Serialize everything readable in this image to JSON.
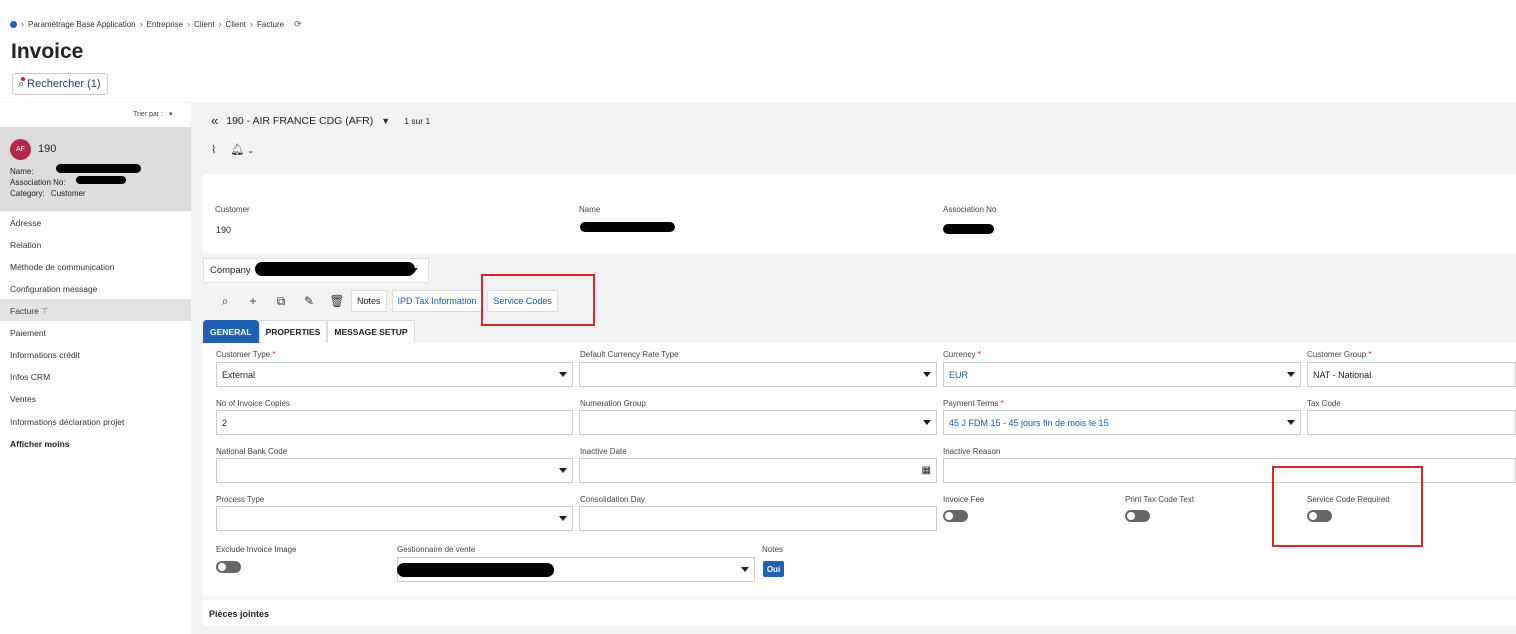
{
  "breadcrumb": [
    "Paramétrage Base Application",
    "Entreprise",
    "Client",
    "Client",
    "Facture"
  ],
  "page_title": "Invoice",
  "search_button": "Rechercher (1)",
  "sidebar": {
    "sort_label": "Trier par :",
    "card": {
      "avatar": "AF",
      "id": "190",
      "name_label": "Name:",
      "association_label": "Association No:",
      "category_label": "Category:",
      "category_value": "Customer"
    },
    "items": [
      "Adresse",
      "Relation",
      "Méthode de communication",
      "Configuration message",
      "Facture",
      "Paiement",
      "Informations crédit",
      "Infos CRM",
      "Ventes",
      "Informations déclaration projet"
    ],
    "show_less": "Afficher moins"
  },
  "record_nav": {
    "record": "190 - AIR FRANCE CDG (AFR)",
    "count": "1 sur 1"
  },
  "header_fields": {
    "customer_label": "Customer",
    "customer_value": "190",
    "name_label": "Name",
    "association_label": "Association No"
  },
  "company_label": "Company",
  "toolbar": {
    "notes": "Notes",
    "ipd": "IPD Tax Information",
    "service_codes": "Service Codes"
  },
  "tabs": [
    "GENERAL",
    "PROPERTIES",
    "MESSAGE SETUP"
  ],
  "form": {
    "customer_type_label": "Customer Type",
    "customer_type_value": "External",
    "default_currency_rate_type_label": "Default Currency Rate Type",
    "currency_label": "Currency",
    "currency_value": "EUR",
    "customer_group_label": "Customer Group",
    "customer_group_value": "NAT - National",
    "invoice_copies_label": "No of Invoice Copies",
    "invoice_copies_value": "2",
    "numeration_group_label": "Numeration Group",
    "payment_terms_label": "Payment Terms",
    "payment_terms_value": "45 J FDM 15 - 45 jours fin de mois le 15",
    "tax_code_label": "Tax Code",
    "national_bank_code_label": "National Bank Code",
    "inactive_date_label": "Inactive Date",
    "inactive_reason_label": "Inactive Reason",
    "process_type_label": "Process Type",
    "consolidation_day_label": "Consolidation Day",
    "invoice_fee_label": "Invoice Fee",
    "print_tax_code_text_label": "Print Tax Code Text",
    "service_code_required_label": "Service Code Required",
    "exclude_invoice_image_label": "Exclude Invoice Image",
    "gestionnaire_label": "Gestionnaire de vente",
    "notes_label": "Notes",
    "notes_value": "Oui"
  },
  "attachments_label": "Pièces jointes",
  "colors": {
    "accent": "#1f5fb4",
    "highlight": "#d9262c",
    "avatar": "#b0284c"
  }
}
